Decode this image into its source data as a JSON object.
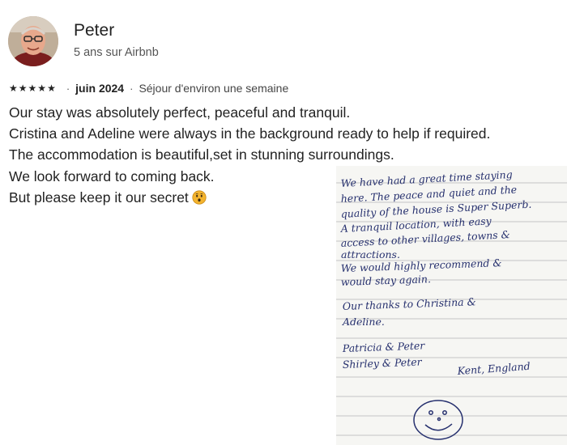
{
  "host": {
    "name": "Peter",
    "tenure": "5 ans sur Airbnb"
  },
  "review": {
    "rating": 5,
    "date": "juin 2024",
    "stay_length": "Séjour d'environ une semaine",
    "lines": [
      "Our stay was absolutely perfect, peaceful and tranquil.",
      "Cristina and Adeline were always in the background ready to help if required.",
      "The accommodation is beautiful,set in stunning surroundings.",
      "We look forward to coming back.",
      "But please keep it our secret"
    ],
    "emoji_icon": "hushed-face-emoji"
  },
  "note": {
    "lines": [
      "We have had a great time staying",
      "here. The peace and quiet and the",
      "quality of the house is Super Superb.",
      "A tranquil location, with easy",
      "access to other villages, towns &",
      "attractions.",
      "We would highly recommend &",
      "would stay again.",
      "Our thanks to Christina &",
      "Adeline.",
      "Patricia & Peter",
      "Shirley & Peter",
      "Kent, England"
    ],
    "drawing": "smiley-face"
  },
  "colors": {
    "text": "#222222",
    "muted": "#555555",
    "ink": "#26306e",
    "emoji": "#f4b42e"
  }
}
